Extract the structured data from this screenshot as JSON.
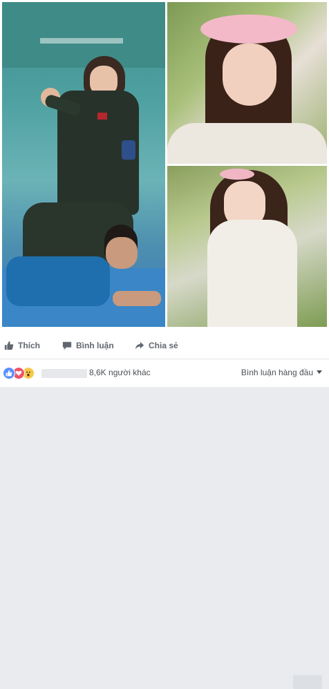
{
  "post": {
    "photos": [
      {
        "name": "photo-training",
        "description": ""
      },
      {
        "name": "photo-portrait-flower-crown",
        "description": ""
      },
      {
        "name": "photo-portrait-lace-dress",
        "description": ""
      }
    ]
  },
  "actions": {
    "like_label": "Thích",
    "comment_label": "Bình luận",
    "share_label": "Chia sẻ"
  },
  "reactions": {
    "icons": [
      "like-icon",
      "love-icon",
      "wow-icon"
    ],
    "others_text": "8,6K người khác"
  },
  "comments": {
    "sort_label": "Bình luận hàng đầu",
    "sort_icon": "caret-down-icon"
  },
  "colors": {
    "like_blue": "#5890ff",
    "love_red": "#f25268",
    "wow_yellow": "#f7c94b",
    "action_gray": "#616770"
  }
}
